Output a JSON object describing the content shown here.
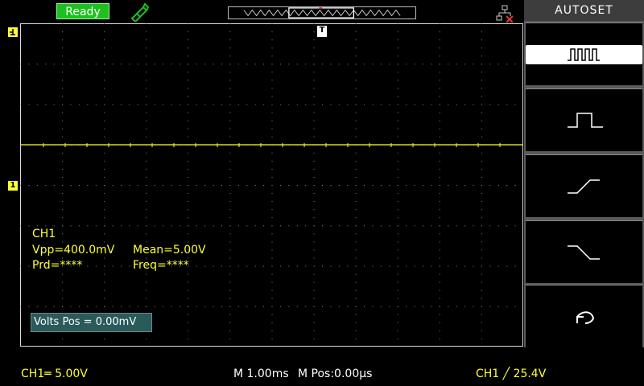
{
  "status": {
    "ready_label": "Ready"
  },
  "menu": {
    "title": "AUTOSET",
    "buttons": [
      {
        "icon": "multi-period-wave-icon"
      },
      {
        "icon": "single-pulse-icon"
      },
      {
        "icon": "rising-edge-icon"
      },
      {
        "icon": "falling-edge-icon"
      },
      {
        "icon": "undo-icon"
      }
    ]
  },
  "channel_marker": "1",
  "trigger_marker": "T",
  "measurements": {
    "channel": "CH1",
    "vpp": "Vpp=400.0mV",
    "mean": "Mean=5.00V",
    "prd": "Prd=****",
    "freq": "Freq=****"
  },
  "volts_pos": "Volts Pos = 0.00mV",
  "footer": {
    "ch1_scale": "CH1═ 5.00V",
    "time_base": "M 1.00ms",
    "m_pos": "M Pos:0.00µs",
    "trigger": "CH1 ╱ 25.4V"
  },
  "colors": {
    "trace": "#ffff33",
    "ready": "#1fbf1f",
    "menu_bg": "#5a5a5a"
  }
}
